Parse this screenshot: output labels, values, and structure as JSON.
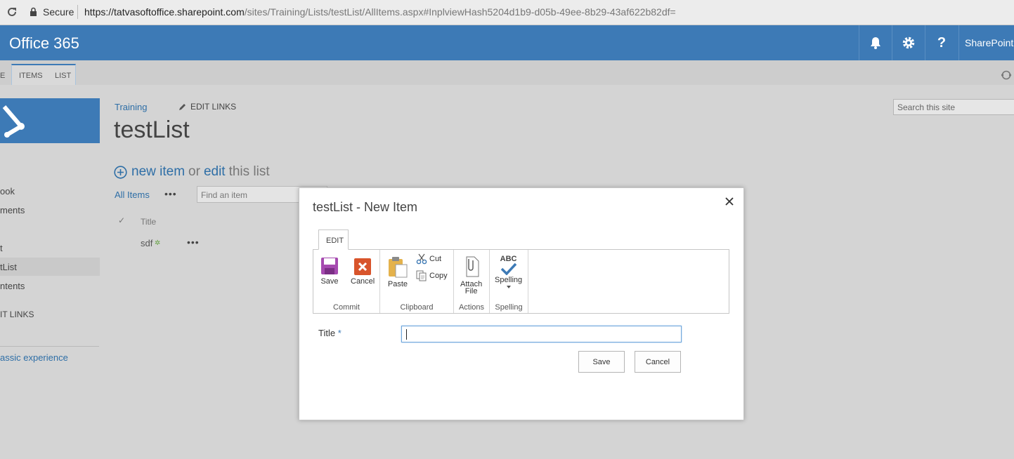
{
  "browser": {
    "secure_label": "Secure",
    "url_host": "https://tatvasoftoffice.sharepoint.com",
    "url_path": "/sites/Training/Lists/testList/AllItems.aspx#InplviewHash5204d1b9-d05b-49ee-8b29-43af622b82df="
  },
  "suite": {
    "brand": "Office 365",
    "app_label": "SharePoint",
    "icons": [
      "bell-icon",
      "gear-icon",
      "help-icon"
    ],
    "color": "#3d7ab6"
  },
  "ribbon_tabs": {
    "partial_left": "E",
    "items_label": "ITEMS",
    "list_label": "LIST"
  },
  "leftnav": {
    "items": [
      "ook",
      "ments",
      "t",
      "tList",
      "ntents",
      "IT LINKS"
    ],
    "classic": "assic experience"
  },
  "page": {
    "breadcrumb": "Training",
    "edit_links": "EDIT LINKS",
    "title": "testList",
    "new_item": "new item",
    "or": "or",
    "edit": "edit",
    "this_list": "this list",
    "all_items": "All Items",
    "more": "•••",
    "find_placeholder": "Find an item",
    "col_check": "✓",
    "col_title": "Title",
    "row_value": "sdf",
    "row_new_badge": "✲",
    "search_placeholder": "Search this site"
  },
  "dialog": {
    "title": "testList - New Item",
    "tab_edit": "EDIT",
    "groups": {
      "commit": "Commit",
      "clipboard": "Clipboard",
      "actions": "Actions",
      "spelling": "Spelling"
    },
    "buttons": {
      "save": "Save",
      "cancel": "Cancel",
      "paste": "Paste",
      "cut": "Cut",
      "copy": "Copy",
      "attach1": "Attach",
      "attach2": "File",
      "spelling": "Spelling",
      "abc": "ABC"
    },
    "field_label": "Title",
    "required": "*",
    "save_btn": "Save",
    "cancel_btn": "Cancel"
  }
}
